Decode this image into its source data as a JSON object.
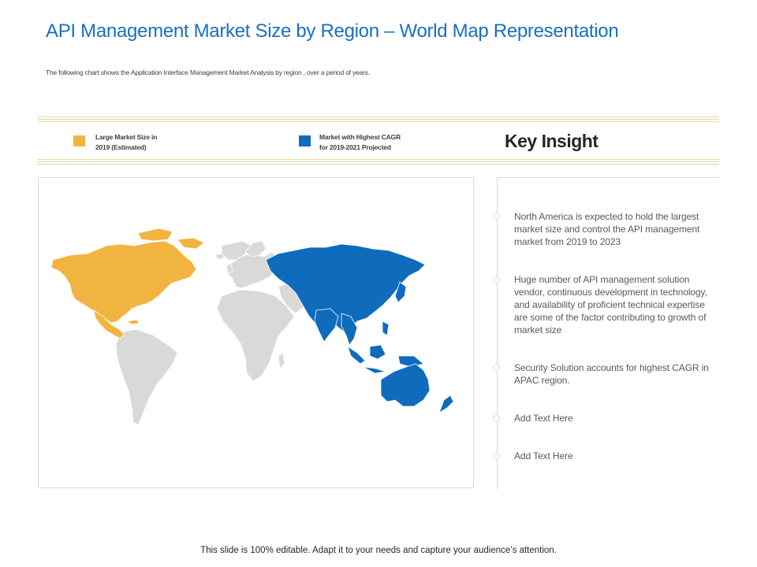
{
  "title": "API Management Market Size by Region – World Map Representation",
  "subtitle": "The following chart shows the Application Interface Management Market Analysis by region , over a period of years.",
  "legend": [
    {
      "line1": "Large Market Size in",
      "line2": "2019 (Estimated)",
      "color": "#f2b441"
    },
    {
      "line1": "Market with Highest CAGR",
      "line2": "for 2019-2021 Projected",
      "color": "#0f6cbd"
    }
  ],
  "key_insight_heading": "Key Insight",
  "map": {
    "type": "choropleth world map",
    "highlighted_regions": [
      {
        "region": "North America",
        "category": "Large Market Size in 2019 (Estimated)",
        "color": "#f2b441"
      },
      {
        "region": "APAC",
        "category": "Market with Highest CAGR for 2019-2021 Projected",
        "color": "#0f6cbd"
      }
    ],
    "other_regions_color": "#d9d9d9"
  },
  "insights": [
    "North America is expected to hold the largest market size and control the API management market from 2019 to 2023",
    "Huge number of API management solution vendor, continuous development in technology, and availability of proficient technical expertise are some of the factor contributing to growth of market size",
    "Security Solution accounts for highest CAGR in APAC region.",
    "Add Text Here",
    "Add Text Here"
  ],
  "footer": "This slide is 100% editable. Adapt it to your needs and capture your audience’s attention."
}
